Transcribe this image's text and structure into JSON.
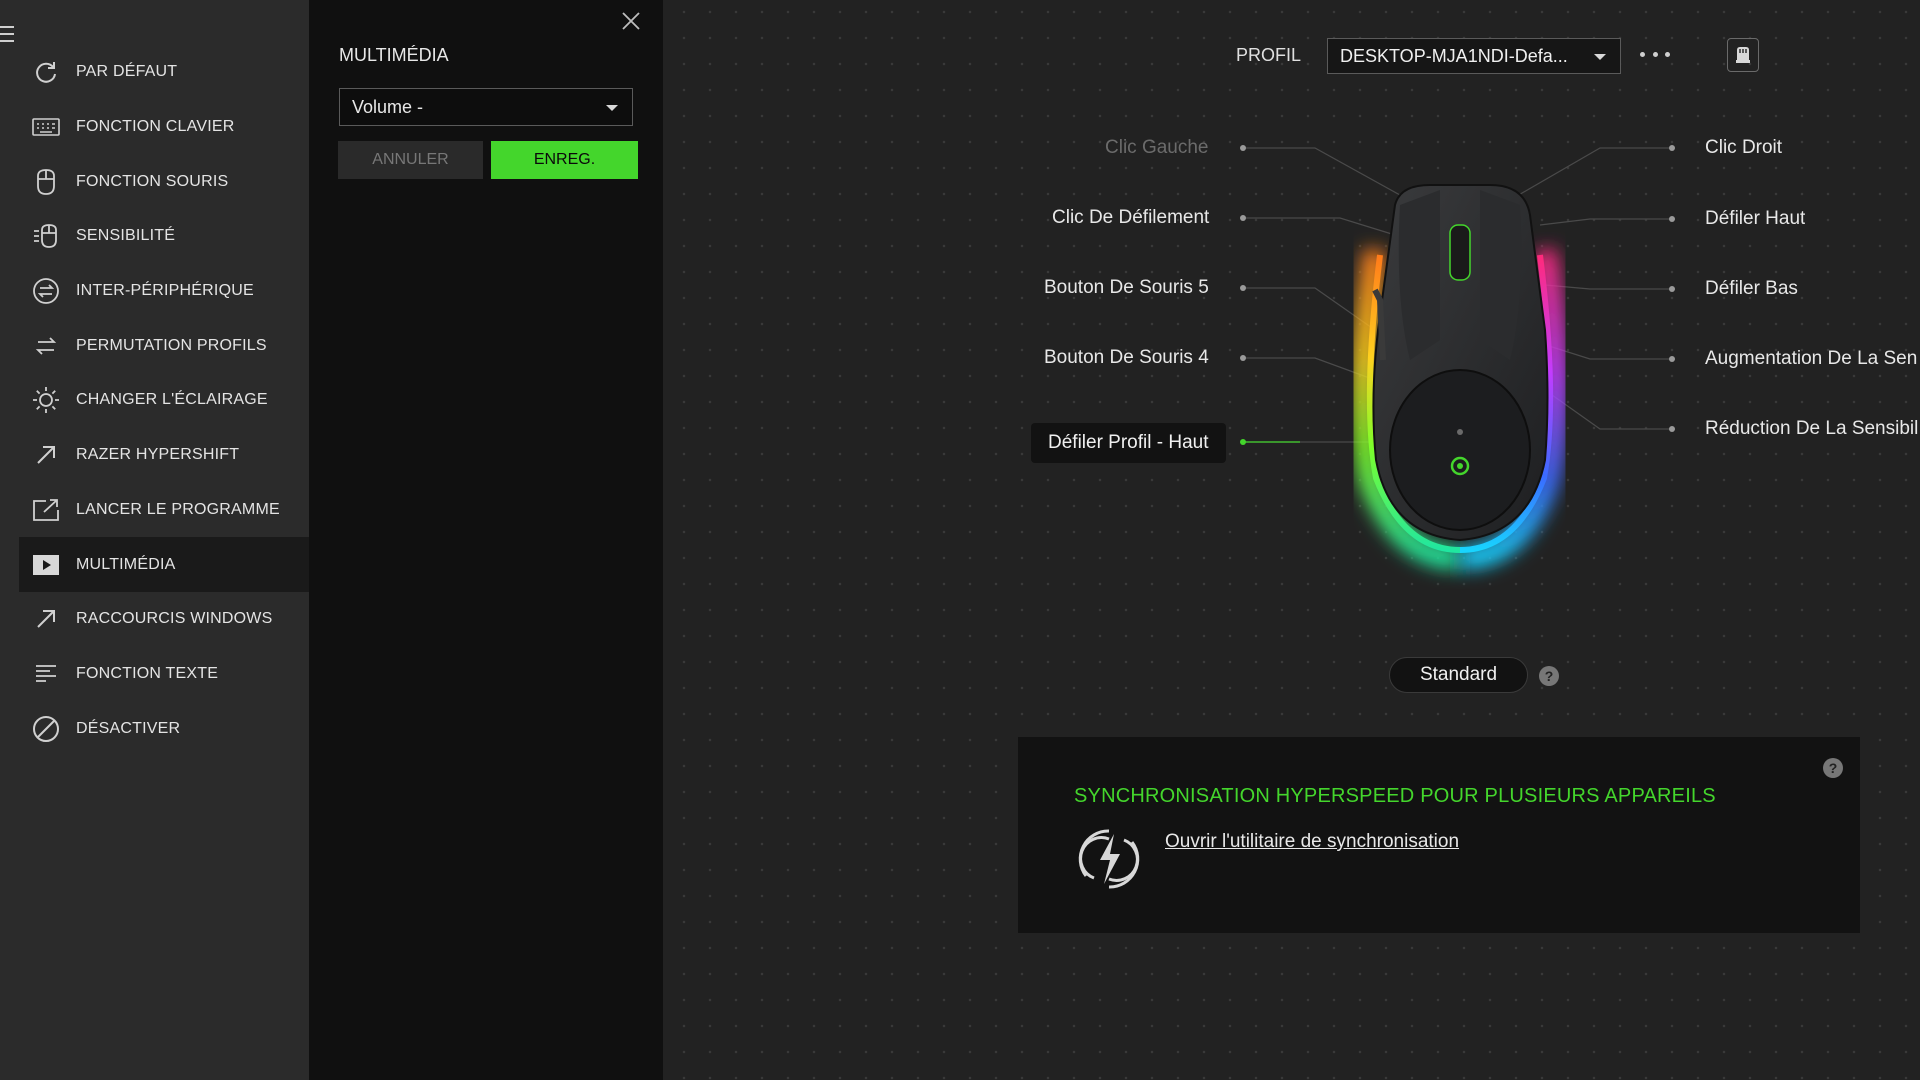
{
  "sidebar": {
    "items": [
      {
        "label": "PAR DÉFAUT",
        "icon": "reset-icon"
      },
      {
        "label": "FONCTION CLAVIER",
        "icon": "keyboard-icon"
      },
      {
        "label": "FONCTION SOURIS",
        "icon": "mouse-icon"
      },
      {
        "label": "SENSIBILITÉ",
        "icon": "sensitivity-icon"
      },
      {
        "label": "INTER-PÉRIPHÉRIQUE",
        "icon": "inter-device-icon"
      },
      {
        "label": "PERMUTATION PROFILS",
        "icon": "switch-profile-icon"
      },
      {
        "label": "CHANGER L'ÉCLAIRAGE",
        "icon": "lighting-icon"
      },
      {
        "label": "RAZER HYPERSHIFT",
        "icon": "hypershift-icon"
      },
      {
        "label": "LANCER LE PROGRAMME",
        "icon": "launch-program-icon"
      },
      {
        "label": "MULTIMÉDIA",
        "icon": "multimedia-icon",
        "active": true
      },
      {
        "label": "RACCOURCIS WINDOWS",
        "icon": "windows-shortcut-icon"
      },
      {
        "label": "FONCTION TEXTE",
        "icon": "text-function-icon"
      },
      {
        "label": "DÉSACTIVER",
        "icon": "disable-icon"
      }
    ]
  },
  "editor": {
    "title": "MULTIMÉDIA",
    "selected_function": "Volume -",
    "cancel_label": "ANNULER",
    "save_label": "ENREG."
  },
  "header": {
    "profile_label": "PROFIL",
    "profile_value": "DESKTOP-MJA1NDI-Defa..."
  },
  "mouse_buttons": {
    "left": [
      {
        "label": "Clic Gauche",
        "state": "dim"
      },
      {
        "label": "Clic De Défilement",
        "state": "normal"
      },
      {
        "label": "Bouton De Souris 5",
        "state": "normal"
      },
      {
        "label": "Bouton De Souris 4",
        "state": "normal"
      },
      {
        "label": "Défiler Profil - Haut",
        "state": "selected"
      }
    ],
    "right": [
      {
        "label": "Clic Droit"
      },
      {
        "label": "Défiler Haut"
      },
      {
        "label": "Défiler  Bas"
      },
      {
        "label": "Augmentation De La Sen"
      },
      {
        "label": "Réduction De La Sensibil"
      }
    ]
  },
  "mode": {
    "label": "Standard",
    "help": "?"
  },
  "sync": {
    "title": "SYNCHRONISATION HYPERSPEED POUR PLUSIEURS APPAREILS",
    "link": "Ouvrir l'utilitaire de synchronisation",
    "help": "?"
  },
  "colors": {
    "accent": "#44d62c",
    "sidebar_bg": "#2b2b2b",
    "editor_bg": "#101010",
    "main_bg": "#222222"
  }
}
